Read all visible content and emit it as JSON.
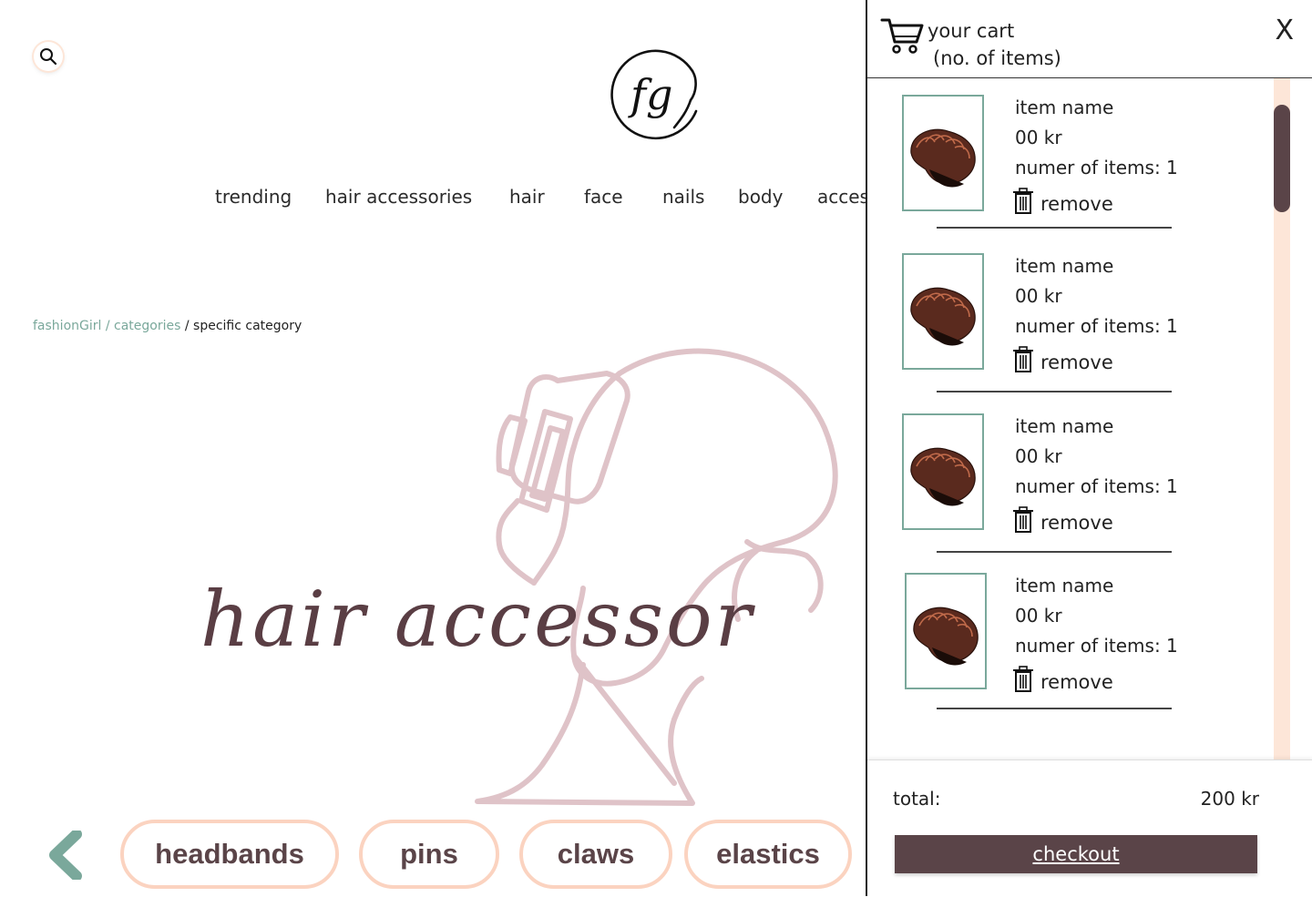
{
  "search": {
    "icon": "search-icon"
  },
  "logo": {
    "text": "fg"
  },
  "nav": {
    "items": [
      {
        "label": "trending"
      },
      {
        "label": "hair accessories"
      },
      {
        "label": "hair"
      },
      {
        "label": "face"
      },
      {
        "label": "nails"
      },
      {
        "label": "body"
      },
      {
        "label": "acces"
      }
    ]
  },
  "breadcrumb": {
    "root": "fashionGirl",
    "sep1": " / ",
    "category": "categories",
    "sep2": " / ",
    "current": "specific category"
  },
  "hero": {
    "title": "hair accessor"
  },
  "chips": [
    {
      "label": "headbands"
    },
    {
      "label": "pins"
    },
    {
      "label": "claws"
    },
    {
      "label": "elastics"
    }
  ],
  "cart": {
    "title": "your cart",
    "count_label": "(no. of items)",
    "close_label": "X",
    "items": [
      {
        "name": "item name",
        "price": "00 kr",
        "qty": "numer of items: 1",
        "remove": "remove"
      },
      {
        "name": "item name",
        "price": "00 kr",
        "qty": "numer of items: 1",
        "remove": "remove"
      },
      {
        "name": "item name",
        "price": "00 kr",
        "qty": "numer of items: 1",
        "remove": "remove"
      },
      {
        "name": "item name",
        "price": "00 kr",
        "qty": "numer of items: 1",
        "remove": "remove"
      }
    ],
    "total_label": "total:",
    "total_value": "200 kr",
    "checkout_label": "checkout"
  },
  "colors": {
    "accent": "#5a4448",
    "teal": "#7aa89b",
    "peach": "#fbd3c0",
    "hero_line": "#dfc3c8"
  }
}
